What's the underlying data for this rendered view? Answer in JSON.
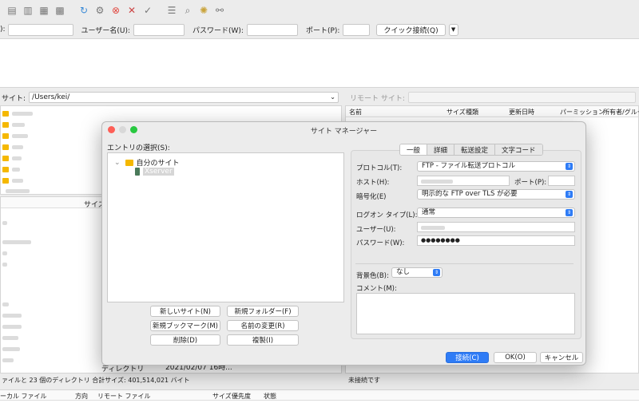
{
  "quickconnect": {
    "host_label": "):",
    "user_label": "ユーザー名(U):",
    "password_label": "パスワード(W):",
    "port_label": "ポート(P):",
    "connect_button": "クイック接続(Q)",
    "dropdown_glyph": "▼"
  },
  "local": {
    "site_label": "サイト:",
    "path": "/Users/kei/",
    "path_chevron": "⌄",
    "list_header_size": "サイズ",
    "row_type": "ディレクトリ",
    "row_date": "2021/02/07 16時...",
    "status": "ァイルと 23 個のディレクトリ 合計サイズ: 401,514,021 バイト"
  },
  "remote": {
    "site_label": "リモート サイト:",
    "headers": [
      "名前",
      "サイズ",
      "種類",
      "更新日時",
      "パーミッション",
      "所有者/グループ"
    ],
    "status": "未接続です"
  },
  "queue": {
    "headers": [
      "ーカル ファイル",
      "方向",
      "リモート ファイル",
      "サイズ",
      "優先度",
      "状態"
    ]
  },
  "dialog": {
    "title": "サイト マネージャー",
    "entry_label": "エントリの選択(S):",
    "tree": {
      "expander": "⌄",
      "root": "自分のサイト",
      "child": "Xserver"
    },
    "buttons": {
      "new_site": "新しいサイト(N)",
      "new_folder": "新規フォルダー(F)",
      "new_bookmark": "新規ブックマーク(M)",
      "rename": "名前の変更(R)",
      "delete": "削除(D)",
      "duplicate": "複製(I)"
    },
    "tabs": [
      "一般",
      "詳細",
      "転送設定",
      "文字コード"
    ],
    "fields": {
      "protocol_label": "プロトコル(T):",
      "protocol_value": "FTP - ファイル転送プロトコル",
      "host_label": "ホスト(H):",
      "port_label": "ポート(P):",
      "encryption_label": "暗号化(E)",
      "encryption_value": "明示的な FTP over TLS が必要",
      "logon_label": "ログオン タイプ(L):",
      "logon_value": "通常",
      "user_label": "ユーザー(U):",
      "password_label": "パスワード(W):",
      "password_value": "●●●●●●●●",
      "bgcolor_label": "背景色(B):",
      "bgcolor_value": "なし",
      "comment_label": "コメント(M):",
      "select_arrow": "⇕"
    },
    "footer": {
      "connect": "接続(C)",
      "ok": "OK(O)",
      "cancel": "キャンセル"
    }
  },
  "colors": {
    "accent": "#2f7cf6",
    "folder": "#f5b800",
    "close": "#fe5f57",
    "minimize": "#febc2e",
    "maximize": "#28c840"
  }
}
